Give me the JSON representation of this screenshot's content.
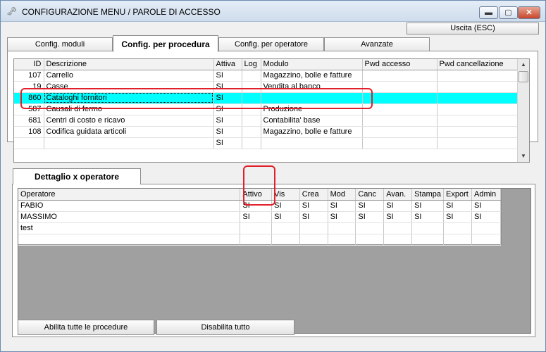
{
  "window": {
    "title": "CONFIGURAZIONE MENU / PAROLE DI ACCESSO",
    "app_icon": "key-icon",
    "controls": {
      "minimize": "▬",
      "maximize": "▢",
      "close": "✕"
    }
  },
  "toolbar": {
    "exit_label": "Uscita (ESC)"
  },
  "tabs": [
    {
      "label": "Config. moduli"
    },
    {
      "label": "Config. per procedura"
    },
    {
      "label": "Config. per operatore"
    },
    {
      "label": "Avanzate"
    }
  ],
  "procedures": {
    "columns": [
      "ID",
      "Descrizione",
      "Attiva",
      "Log",
      "Modulo",
      "Pwd accesso",
      "Pwd cancellazione"
    ],
    "rows": [
      {
        "id": "107",
        "descrizione": "Carrello",
        "attiva": "SI",
        "log": "",
        "modulo": "Magazzino, bolle e fatture",
        "pwd_accesso": "",
        "pwd_canc": ""
      },
      {
        "id": "19",
        "descrizione": "Casse",
        "attiva": "SI",
        "log": "",
        "modulo": "Vendita al banco",
        "pwd_accesso": "",
        "pwd_canc": ""
      },
      {
        "id": "860",
        "descrizione": "Cataloghi fornitori",
        "attiva": "SI",
        "log": "",
        "modulo": "",
        "pwd_accesso": "",
        "pwd_canc": ""
      },
      {
        "id": "587",
        "descrizione": "Causali di fermo",
        "attiva": "SI",
        "log": "",
        "modulo": "Produzione",
        "pwd_accesso": "",
        "pwd_canc": ""
      },
      {
        "id": "681",
        "descrizione": "Centri di costo e ricavo",
        "attiva": "SI",
        "log": "",
        "modulo": "Contabilita' base",
        "pwd_accesso": "",
        "pwd_canc": ""
      },
      {
        "id": "108",
        "descrizione": "Codifica guidata articoli",
        "attiva": "SI",
        "log": "",
        "modulo": "Magazzino, bolle e fatture",
        "pwd_accesso": "",
        "pwd_canc": ""
      },
      {
        "id": "",
        "descrizione": "",
        "attiva": "SI",
        "log": "",
        "modulo": "",
        "pwd_accesso": "",
        "pwd_canc": ""
      }
    ],
    "selected_row": 2
  },
  "detail_tab": {
    "label": "Dettaglio x operatore"
  },
  "operators": {
    "columns": [
      "Operatore",
      "Attivo",
      "Vis",
      "Crea",
      "Mod",
      "Canc",
      "Avan.",
      "Stampa",
      "Export",
      "Admin"
    ],
    "rows": [
      {
        "name": "FABIO",
        "values": [
          "SI",
          "SI",
          "SI",
          "SI",
          "SI",
          "SI",
          "SI",
          "SI",
          "SI"
        ]
      },
      {
        "name": "MASSIMO",
        "values": [
          "SI",
          "SI",
          "SI",
          "SI",
          "SI",
          "SI",
          "SI",
          "SI",
          "SI"
        ]
      },
      {
        "name": "test",
        "values": [
          "",
          "",
          "",
          "",
          "",
          "",
          "",
          "",
          ""
        ]
      }
    ]
  },
  "buttons": {
    "enable_all": "Abilita tutte le procedure",
    "disable_all": "Disabilita tutto"
  },
  "colors": {
    "selection": "#00ffff",
    "highlight_box": "#e0202a"
  }
}
